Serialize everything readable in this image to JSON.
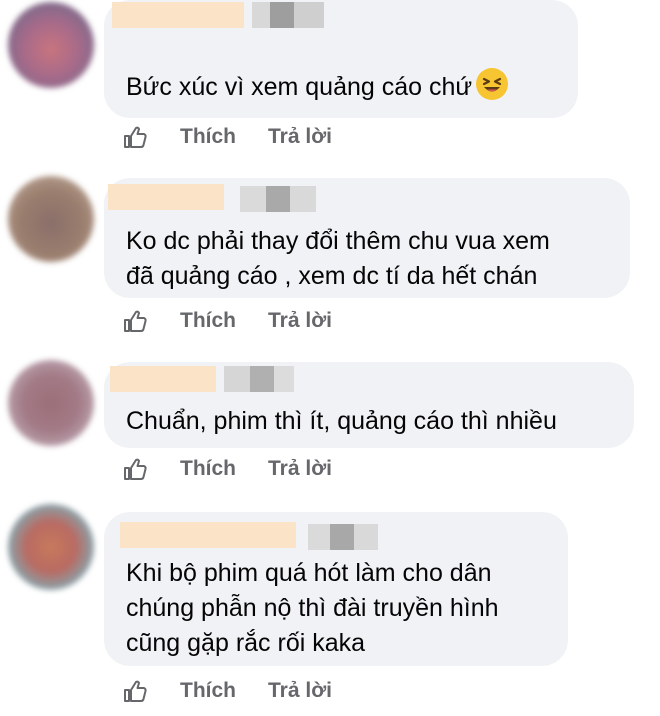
{
  "comments": [
    {
      "text_lines": [
        "Bức xúc vì xem quảng cáo chứ"
      ],
      "emoji": "laughing-emoji",
      "like_label": "Thích",
      "reply_label": "Trả lời"
    },
    {
      "text_lines": [
        "Ko dc phải thay đổi thêm chu vua xem",
        "đã quảng cáo , xem dc tí da hết chán"
      ],
      "like_label": "Thích",
      "reply_label": "Trả lời"
    },
    {
      "text_lines": [
        "Chuẩn, phim thì ít, quảng cáo thì nhiều"
      ],
      "like_label": "Thích",
      "reply_label": "Trả lời"
    },
    {
      "text_lines": [
        "Khi bộ phim quá hót làm cho dân",
        "chúng phẫn nộ thì đài truyền hình",
        "cũng gặp rắc rối kaka"
      ],
      "like_label": "Thích",
      "reply_label": "Trả lời"
    }
  ],
  "colors": {
    "bubble": "#f0f2f5",
    "text": "#050505",
    "action": "#65676b"
  },
  "icons": {
    "like": "like-icon"
  }
}
